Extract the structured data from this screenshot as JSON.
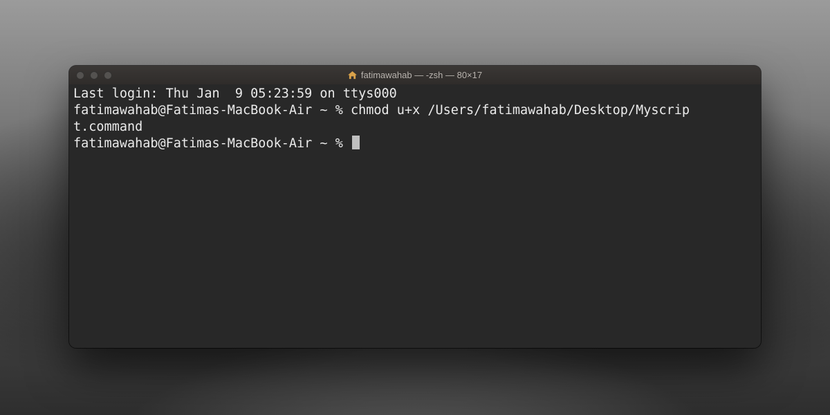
{
  "window": {
    "title": "fatimawahab — -zsh — 80×17",
    "home_icon_name": "home-icon"
  },
  "terminal": {
    "last_login": "Last login: Thu Jan  9 05:23:59 on ttys000",
    "line1_prompt": "fatimawahab@Fatimas-MacBook-Air ~ % ",
    "line1_cmd_a": "chmod u+x /Users/fatimawahab/Desktop/Myscrip",
    "line1_cmd_b": "t.command",
    "line2_prompt": "fatimawahab@Fatimas-MacBook-Air ~ % "
  }
}
